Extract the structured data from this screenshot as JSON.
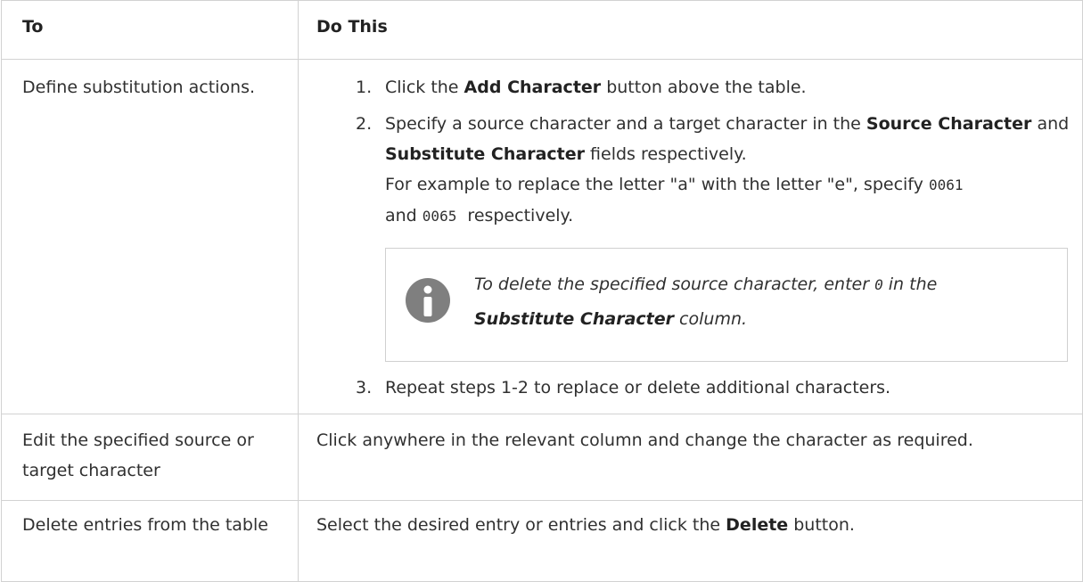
{
  "table": {
    "headers": {
      "to": "To",
      "do_this": "Do This"
    },
    "row1": {
      "to": "Define substitution actions.",
      "step1": {
        "num": "1.",
        "pre": "Click the",
        "bold": "Add Character",
        "post": "button above the table."
      },
      "step2": {
        "num": "2.",
        "pre": "Specify a source character and a target character in the",
        "bold1": "Source Character",
        "mid": "and",
        "bold2": "Substitute Character",
        "post": "fields respectively.",
        "example_pre": "For example to replace the letter \"a\" with the letter \"e\", specify",
        "code1": "0061",
        "example_and": "and",
        "code2": "0065",
        "example_post": "respectively."
      },
      "note": {
        "pre": "To delete the specified source character, enter",
        "code": "0",
        "mid": "in the",
        "bold": "Substitute Character",
        "post": "column.",
        "icon": "info-icon",
        "icon_color": "#7f7f7f"
      },
      "step3": {
        "num": "3.",
        "text": "Repeat steps 1-2 to replace or delete additional characters."
      }
    },
    "row2": {
      "to": "Edit the specified source or target character",
      "do": "Click anywhere in the relevant column and change the character as required."
    },
    "row3": {
      "to": "Delete entries from the table",
      "pre": "Select the desired entry or entries and click the",
      "bold": "Delete",
      "post": "button."
    }
  }
}
